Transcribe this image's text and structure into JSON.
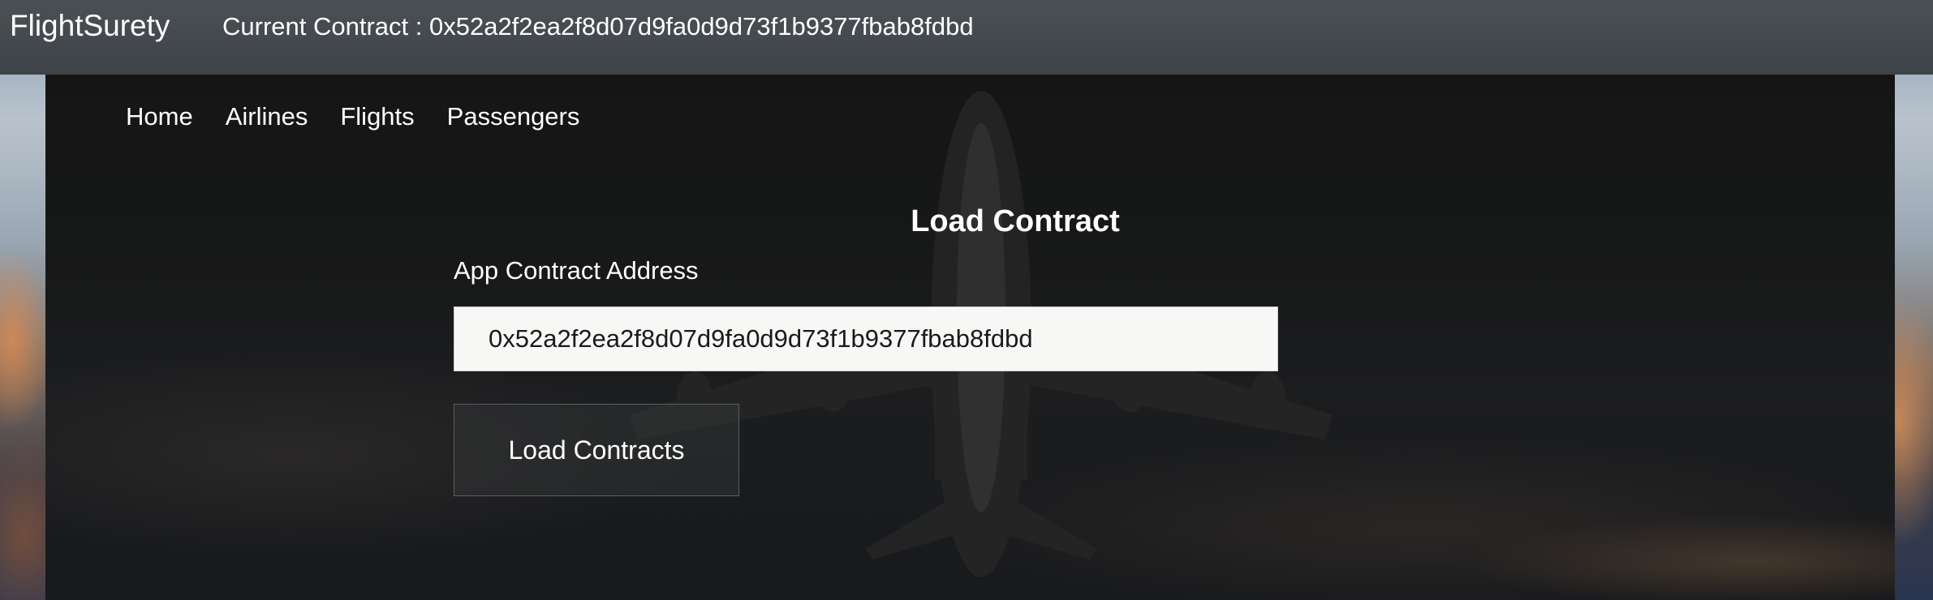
{
  "navbar": {
    "brand": "FlightSurety",
    "current_contract": "Current Contract : 0x52a2f2ea2f8d07d9fa0d9d73f1b9377fbab8fdbd"
  },
  "nav": {
    "items": [
      {
        "label": "Home"
      },
      {
        "label": "Airlines"
      },
      {
        "label": "Flights"
      },
      {
        "label": "Passengers"
      }
    ]
  },
  "load_contract": {
    "heading": "Load Contract",
    "field_label": "App Contract Address",
    "address_value": "0x52a2f2ea2f8d07d9fa0d9d73f1b9377fbab8fdbd",
    "button_label": "Load Contracts"
  },
  "colors": {
    "navbar_bg": "#444a50",
    "panel_bg": "#171818",
    "text": "#ffffff",
    "input_bg": "#f7f7f6"
  },
  "background_image": "airplane-landing-at-sunset"
}
